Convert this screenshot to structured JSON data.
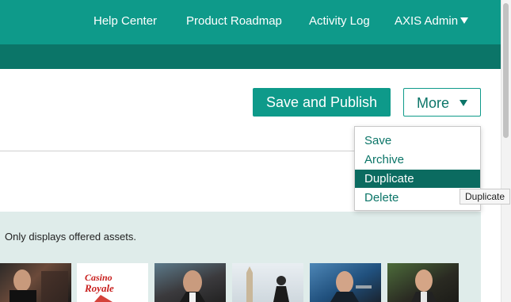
{
  "header": {
    "nav": [
      {
        "label": "Help Center"
      },
      {
        "label": "Product Roadmap"
      },
      {
        "label": "Activity Log"
      },
      {
        "label": "AXIS Admin"
      }
    ]
  },
  "actions": {
    "primary_label": "Save and Publish",
    "more_label": "More"
  },
  "more_menu": {
    "items": [
      {
        "label": "Save"
      },
      {
        "label": "Archive"
      },
      {
        "label": "Duplicate",
        "active": true
      },
      {
        "label": "Delete"
      }
    ],
    "tooltip": "Duplicate"
  },
  "assets": {
    "note": "Only displays offered assets.",
    "thumbnail_count": 6,
    "thumbnail_logo_text": "Casino Royale"
  },
  "colors": {
    "header": "#0e9a8a",
    "subheader": "#0b7568",
    "menu_active": "#0b6b60",
    "assets_panel": "#dfecea"
  }
}
